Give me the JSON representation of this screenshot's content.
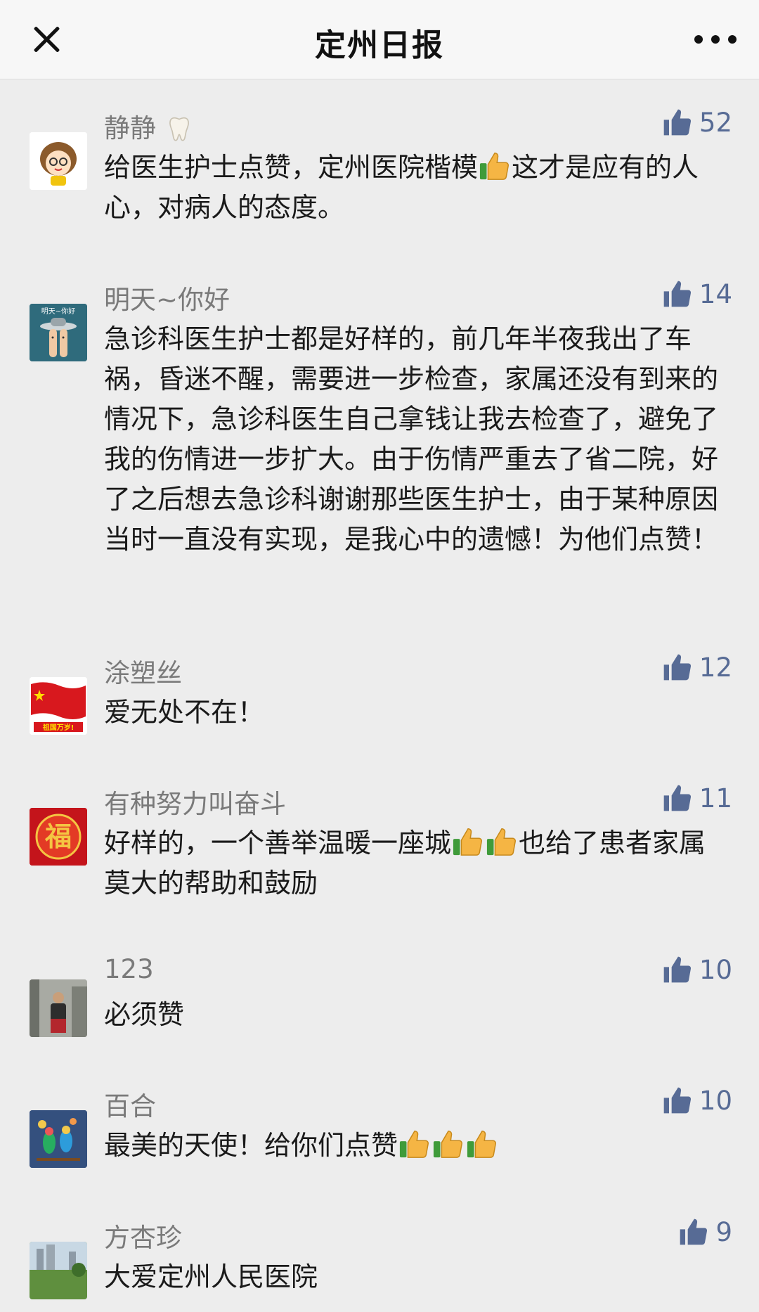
{
  "header": {
    "title": "定州日报",
    "close_icon": "close-icon",
    "more_icon": "more-icon"
  },
  "colors": {
    "background": "#ededed",
    "like_blue": "#576b95",
    "name_gray": "#7a7a7a",
    "text": "#1a1a1a"
  },
  "comments": [
    {
      "name": "静静",
      "name_emoji": "tooth-icon",
      "likes": "52",
      "text_parts": [
        "给医生护士点赞，定州医院楷模",
        "这才是应有的人心，对病人的态度。"
      ],
      "emojis": [
        "thumbs-up-emoji"
      ]
    },
    {
      "name": "明天~你好",
      "avatar_text": "明天~你好",
      "likes": "14",
      "text": "急诊科医生护士都是好样的，前几年半夜我出了车祸，昏迷不醒，需要进一步检查，家属还没有到来的情况下，急诊科医生自己拿钱让我去检查了，避免了我的伤情进一步扩大。由于伤情严重去了省二院，好了之后想去急诊科谢谢那些医生护士，由于某种原因当时一直没有实现，是我心中的遗憾！为他们点赞！"
    },
    {
      "name": "涂塑丝",
      "avatar_text": "祖国万岁!",
      "likes": "12",
      "text": "爱无处不在！"
    },
    {
      "name": "有种努力叫奋斗",
      "avatar_text": "福",
      "likes": "11",
      "text_parts": [
        "好样的，一个善举温暖一座城",
        "也给了患者家属莫大的帮助和鼓励"
      ],
      "emojis": [
        "thumbs-up-emoji",
        "thumbs-up-emoji"
      ]
    },
    {
      "name": "123",
      "likes": "10",
      "text": "必须赞"
    },
    {
      "name": "百合",
      "likes": "10",
      "text": "最美的天使！给你们点赞",
      "emojis": [
        "thumbs-up-emoji",
        "thumbs-up-emoji",
        "thumbs-up-emoji"
      ]
    },
    {
      "name": "方杏珍",
      "likes": "9",
      "text": "大爱定州人民医院"
    }
  ]
}
